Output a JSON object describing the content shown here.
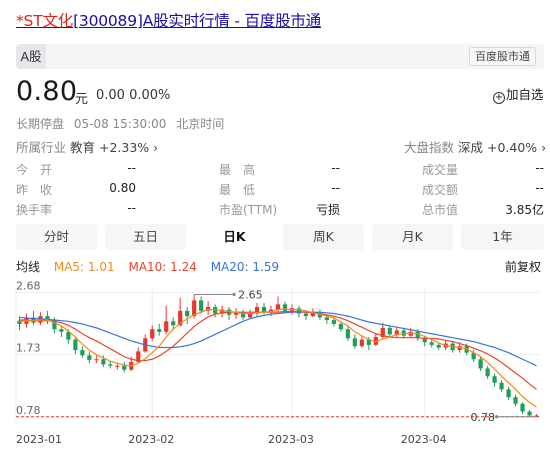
{
  "title": {
    "st": "*ST文化",
    "code_part": "[300089]A股实时行情 - 百度股市通"
  },
  "topbar": {
    "tab": "A股",
    "brand": "百度股市通"
  },
  "quote": {
    "price": "0.80",
    "unit": "元",
    "change": "0.00  0.00%",
    "add_fav": "加自选"
  },
  "status": {
    "state": "长期停盘",
    "time": "05-08 15:30:00",
    "zone": "北京时间"
  },
  "industry": {
    "label": "所属行业",
    "value": "教育 +2.33%",
    "arrow": "›"
  },
  "market_index": {
    "label": "大盘指数",
    "value": "深成 +0.40%",
    "arrow": "›"
  },
  "stats": [
    {
      "label": "今　开",
      "value": "--"
    },
    {
      "label": "最　高",
      "value": "--"
    },
    {
      "label": "成交量",
      "value": "--"
    },
    {
      "label": "昨　收",
      "value": "0.80"
    },
    {
      "label": "最　低",
      "value": "--"
    },
    {
      "label": "成交额",
      "value": "--"
    },
    {
      "label": "换手率",
      "value": "--"
    },
    {
      "label": "市盈(TTM)",
      "value": "亏损"
    },
    {
      "label": "总市值",
      "value": "3.85亿"
    }
  ],
  "periods": [
    "分时",
    "五日",
    "日K",
    "周K",
    "月K",
    "1年"
  ],
  "active_period": "日K",
  "ma": {
    "label": "均线",
    "ma5": "MA5: 1.01",
    "ma10": "MA10: 1.24",
    "ma20": "MA20: 1.59",
    "ma5_color": "#f08c1c",
    "ma10_color": "#e8452c",
    "ma20_color": "#3a73d9",
    "adjust": "前复权"
  },
  "colors": {
    "up": "#e8372c",
    "down": "#1e9e5a",
    "accent_blue": "#1a0dab"
  },
  "chart_data": {
    "type": "candlestick",
    "y_ticks": [
      "2.68",
      "1.73",
      "0.78"
    ],
    "x_ticks": [
      "2023-01",
      "2023-02",
      "2023-03",
      "2023-04"
    ],
    "annotations": {
      "max": "2.65",
      "min": "0.78"
    },
    "ylim": [
      0.7,
      2.75
    ],
    "candles": [
      {
        "o": 2.25,
        "c": 2.2,
        "h": 2.32,
        "l": 2.1
      },
      {
        "o": 2.2,
        "c": 2.3,
        "h": 2.36,
        "l": 2.14
      },
      {
        "o": 2.3,
        "c": 2.22,
        "h": 2.4,
        "l": 2.18
      },
      {
        "o": 2.22,
        "c": 2.32,
        "h": 2.38,
        "l": 2.18
      },
      {
        "o": 2.32,
        "c": 2.26,
        "h": 2.4,
        "l": 2.2
      },
      {
        "o": 2.26,
        "c": 2.12,
        "h": 2.3,
        "l": 2.06
      },
      {
        "o": 2.12,
        "c": 2.08,
        "h": 2.18,
        "l": 2.0
      },
      {
        "o": 2.08,
        "c": 1.96,
        "h": 2.12,
        "l": 1.9
      },
      {
        "o": 1.96,
        "c": 1.8,
        "h": 2.0,
        "l": 1.74
      },
      {
        "o": 1.8,
        "c": 1.72,
        "h": 1.86,
        "l": 1.68
      },
      {
        "o": 1.72,
        "c": 1.65,
        "h": 1.78,
        "l": 1.6
      },
      {
        "o": 1.65,
        "c": 1.66,
        "h": 1.72,
        "l": 1.6
      },
      {
        "o": 1.66,
        "c": 1.58,
        "h": 1.72,
        "l": 1.54
      },
      {
        "o": 1.58,
        "c": 1.56,
        "h": 1.63,
        "l": 1.52
      },
      {
        "o": 1.56,
        "c": 1.56,
        "h": 1.6,
        "l": 1.5
      },
      {
        "o": 1.56,
        "c": 1.5,
        "h": 1.62,
        "l": 1.46
      },
      {
        "o": 1.5,
        "c": 1.62,
        "h": 1.7,
        "l": 1.48
      },
      {
        "o": 1.62,
        "c": 1.78,
        "h": 1.84,
        "l": 1.6
      },
      {
        "o": 1.78,
        "c": 1.98,
        "h": 2.04,
        "l": 1.76
      },
      {
        "o": 1.98,
        "c": 2.12,
        "h": 2.18,
        "l": 1.94
      },
      {
        "o": 2.12,
        "c": 2.08,
        "h": 2.2,
        "l": 2.02
      },
      {
        "o": 2.08,
        "c": 2.24,
        "h": 2.48,
        "l": 2.04
      },
      {
        "o": 2.24,
        "c": 2.18,
        "h": 2.3,
        "l": 2.12
      },
      {
        "o": 2.18,
        "c": 2.4,
        "h": 2.6,
        "l": 2.16
      },
      {
        "o": 2.4,
        "c": 2.32,
        "h": 2.46,
        "l": 2.2
      },
      {
        "o": 2.32,
        "c": 2.56,
        "h": 2.65,
        "l": 2.28
      },
      {
        "o": 2.56,
        "c": 2.4,
        "h": 2.62,
        "l": 2.36
      },
      {
        "o": 2.4,
        "c": 2.46,
        "h": 2.55,
        "l": 2.34
      },
      {
        "o": 2.46,
        "c": 2.36,
        "h": 2.5,
        "l": 2.3
      },
      {
        "o": 2.36,
        "c": 2.42,
        "h": 2.48,
        "l": 2.3
      },
      {
        "o": 2.42,
        "c": 2.34,
        "h": 2.46,
        "l": 2.26
      },
      {
        "o": 2.34,
        "c": 2.38,
        "h": 2.44,
        "l": 2.28
      },
      {
        "o": 2.38,
        "c": 2.3,
        "h": 2.42,
        "l": 2.26
      },
      {
        "o": 2.3,
        "c": 2.36,
        "h": 2.42,
        "l": 2.28
      },
      {
        "o": 2.36,
        "c": 2.46,
        "h": 2.52,
        "l": 2.32
      },
      {
        "o": 2.46,
        "c": 2.38,
        "h": 2.52,
        "l": 2.34
      },
      {
        "o": 2.38,
        "c": 2.42,
        "h": 2.48,
        "l": 2.32
      },
      {
        "o": 2.42,
        "c": 2.5,
        "h": 2.62,
        "l": 2.38
      },
      {
        "o": 2.5,
        "c": 2.4,
        "h": 2.54,
        "l": 2.36
      },
      {
        "o": 2.4,
        "c": 2.44,
        "h": 2.5,
        "l": 2.34
      },
      {
        "o": 2.44,
        "c": 2.36,
        "h": 2.48,
        "l": 2.3
      },
      {
        "o": 2.36,
        "c": 2.32,
        "h": 2.4,
        "l": 2.26
      },
      {
        "o": 2.32,
        "c": 2.38,
        "h": 2.44,
        "l": 2.3
      },
      {
        "o": 2.38,
        "c": 2.3,
        "h": 2.42,
        "l": 2.26
      },
      {
        "o": 2.3,
        "c": 2.26,
        "h": 2.34,
        "l": 2.2
      },
      {
        "o": 2.26,
        "c": 2.2,
        "h": 2.3,
        "l": 2.16
      },
      {
        "o": 2.2,
        "c": 2.12,
        "h": 2.24,
        "l": 2.08
      },
      {
        "o": 2.12,
        "c": 1.98,
        "h": 2.16,
        "l": 1.94
      },
      {
        "o": 1.98,
        "c": 1.86,
        "h": 2.04,
        "l": 1.82
      },
      {
        "o": 1.86,
        "c": 1.96,
        "h": 2.02,
        "l": 1.84
      },
      {
        "o": 1.96,
        "c": 1.88,
        "h": 2.0,
        "l": 1.8
      },
      {
        "o": 1.88,
        "c": 2.0,
        "h": 2.06,
        "l": 1.86
      },
      {
        "o": 2.0,
        "c": 2.14,
        "h": 2.22,
        "l": 1.98
      },
      {
        "o": 2.14,
        "c": 2.04,
        "h": 2.18,
        "l": 2.0
      },
      {
        "o": 2.04,
        "c": 2.1,
        "h": 2.16,
        "l": 2.0
      },
      {
        "o": 2.1,
        "c": 2.02,
        "h": 2.14,
        "l": 1.98
      },
      {
        "o": 2.02,
        "c": 2.08,
        "h": 2.14,
        "l": 1.98
      },
      {
        "o": 2.08,
        "c": 1.98,
        "h": 2.12,
        "l": 1.94
      },
      {
        "o": 1.98,
        "c": 1.92,
        "h": 2.02,
        "l": 1.86
      },
      {
        "o": 1.92,
        "c": 1.88,
        "h": 1.96,
        "l": 1.84
      },
      {
        "o": 1.88,
        "c": 1.84,
        "h": 1.92,
        "l": 1.8
      },
      {
        "o": 1.84,
        "c": 1.9,
        "h": 1.94,
        "l": 1.8
      },
      {
        "o": 1.9,
        "c": 1.8,
        "h": 1.94,
        "l": 1.76
      },
      {
        "o": 1.8,
        "c": 1.86,
        "h": 1.92,
        "l": 1.76
      },
      {
        "o": 1.86,
        "c": 1.76,
        "h": 1.9,
        "l": 1.72
      },
      {
        "o": 1.76,
        "c": 1.66,
        "h": 1.8,
        "l": 1.62
      },
      {
        "o": 1.66,
        "c": 1.52,
        "h": 1.7,
        "l": 1.48
      },
      {
        "o": 1.52,
        "c": 1.4,
        "h": 1.56,
        "l": 1.36
      },
      {
        "o": 1.4,
        "c": 1.3,
        "h": 1.44,
        "l": 1.24
      },
      {
        "o": 1.3,
        "c": 1.2,
        "h": 1.34,
        "l": 1.16
      },
      {
        "o": 1.2,
        "c": 1.08,
        "h": 1.24,
        "l": 1.04
      },
      {
        "o": 1.08,
        "c": 0.98,
        "h": 1.12,
        "l": 0.94
      },
      {
        "o": 0.98,
        "c": 0.86,
        "h": 1.0,
        "l": 0.82
      },
      {
        "o": 0.86,
        "c": 0.8,
        "h": 0.88,
        "l": 0.78
      },
      {
        "o": 0.8,
        "c": 0.8,
        "h": 0.82,
        "l": 0.78
      }
    ],
    "ma5": [
      2.24,
      2.25,
      2.25,
      2.26,
      2.26,
      2.22,
      2.17,
      2.09,
      2.0,
      1.89,
      1.8,
      1.73,
      1.68,
      1.63,
      1.6,
      1.57,
      1.56,
      1.6,
      1.67,
      1.76,
      1.86,
      2.0,
      2.12,
      2.21,
      2.28,
      2.34,
      2.38,
      2.42,
      2.42,
      2.4,
      2.39,
      2.38,
      2.36,
      2.36,
      2.37,
      2.38,
      2.39,
      2.42,
      2.43,
      2.42,
      2.42,
      2.4,
      2.37,
      2.35,
      2.32,
      2.29,
      2.23,
      2.17,
      2.08,
      2.02,
      1.96,
      1.93,
      1.97,
      2.0,
      2.04,
      2.05,
      2.06,
      2.05,
      2.01,
      1.96,
      1.91,
      1.87,
      1.85,
      1.84,
      1.82,
      1.76,
      1.7,
      1.61,
      1.51,
      1.4,
      1.3,
      1.2,
      1.09,
      1.0,
      0.93
    ],
    "ma10": [
      2.26,
      2.26,
      2.25,
      2.25,
      2.25,
      2.24,
      2.22,
      2.18,
      2.12,
      2.05,
      1.99,
      1.94,
      1.88,
      1.82,
      1.76,
      1.7,
      1.66,
      1.64,
      1.64,
      1.66,
      1.71,
      1.78,
      1.86,
      1.96,
      2.06,
      2.16,
      2.24,
      2.31,
      2.35,
      2.37,
      2.38,
      2.38,
      2.38,
      2.38,
      2.38,
      2.38,
      2.38,
      2.38,
      2.39,
      2.39,
      2.39,
      2.38,
      2.37,
      2.36,
      2.34,
      2.32,
      2.29,
      2.25,
      2.2,
      2.15,
      2.1,
      2.05,
      2.02,
      2.0,
      1.99,
      1.99,
      1.99,
      1.99,
      1.98,
      1.98,
      1.97,
      1.95,
      1.93,
      1.9,
      1.87,
      1.83,
      1.79,
      1.74,
      1.68,
      1.61,
      1.53,
      1.45,
      1.37,
      1.28,
      1.2
    ],
    "ma20": [
      2.3,
      2.29,
      2.28,
      2.28,
      2.27,
      2.26,
      2.25,
      2.24,
      2.22,
      2.2,
      2.17,
      2.14,
      2.1,
      2.06,
      2.02,
      1.98,
      1.94,
      1.91,
      1.88,
      1.86,
      1.84,
      1.84,
      1.84,
      1.85,
      1.87,
      1.9,
      1.94,
      1.99,
      2.04,
      2.09,
      2.14,
      2.19,
      2.24,
      2.28,
      2.31,
      2.33,
      2.35,
      2.36,
      2.37,
      2.38,
      2.38,
      2.38,
      2.38,
      2.38,
      2.37,
      2.36,
      2.34,
      2.32,
      2.29,
      2.26,
      2.23,
      2.21,
      2.19,
      2.17,
      2.15,
      2.13,
      2.11,
      2.09,
      2.07,
      2.05,
      2.03,
      2.01,
      1.99,
      1.97,
      1.95,
      1.93,
      1.9,
      1.87,
      1.84,
      1.8,
      1.76,
      1.71,
      1.66,
      1.61,
      1.56
    ]
  }
}
